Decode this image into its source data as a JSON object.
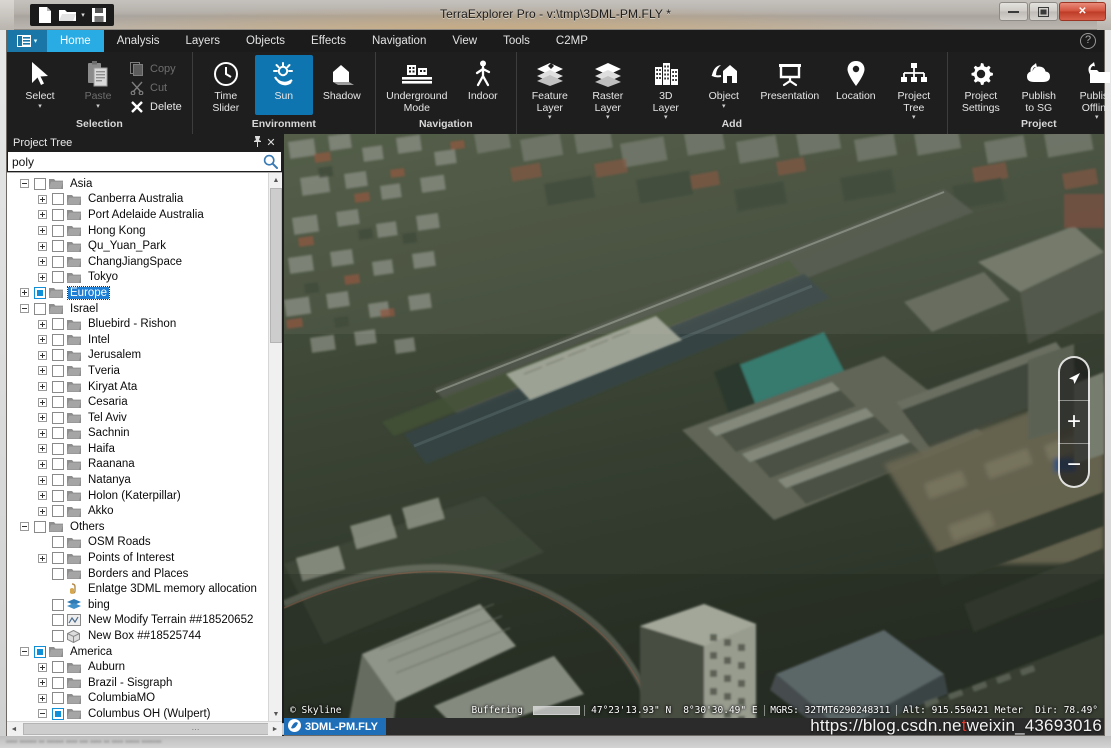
{
  "window": {
    "title": "TerraExplorer Pro - v:\\tmp\\3DML-PM.FLY *",
    "minimize": "—",
    "maximize": "❐",
    "close": "✕"
  },
  "quick_access": {
    "new": "new-document",
    "open": "open-folder",
    "open_caret": "▾",
    "save": "save-disk"
  },
  "ribbon": {
    "app_menu_caret": "▾",
    "help": "?",
    "tabs": [
      {
        "label": "Home",
        "active": true
      },
      {
        "label": "Analysis",
        "active": false
      },
      {
        "label": "Layers",
        "active": false
      },
      {
        "label": "Objects",
        "active": false
      },
      {
        "label": "Effects",
        "active": false
      },
      {
        "label": "Navigation",
        "active": false
      },
      {
        "label": "View",
        "active": false
      },
      {
        "label": "Tools",
        "active": false
      },
      {
        "label": "C2MP",
        "active": false
      }
    ],
    "groups": [
      {
        "title": "Selection",
        "big": [
          {
            "label": "Select",
            "caret": "▾",
            "icon": "cursor-arrow-icon",
            "selected": false,
            "disabled": false
          },
          {
            "label": "Paste",
            "caret": "▾",
            "icon": "clipboard-paste-icon",
            "selected": false,
            "disabled": true
          }
        ],
        "small": [
          {
            "label": "Copy",
            "icon": "copy-icon",
            "disabled": true
          },
          {
            "label": "Cut",
            "icon": "scissors-cut-icon",
            "disabled": true
          },
          {
            "label": "Delete",
            "icon": "delete-x-icon",
            "disabled": false
          }
        ]
      },
      {
        "title": "Environment",
        "big": [
          {
            "label": "Time\nSlider",
            "caret": "",
            "icon": "clock-icon",
            "selected": false,
            "disabled": false
          },
          {
            "label": "Sun",
            "caret": "",
            "icon": "sun-icon",
            "selected": true,
            "disabled": false
          },
          {
            "label": "Shadow",
            "caret": "",
            "icon": "house-shadow-icon",
            "selected": false,
            "disabled": false
          }
        ],
        "small": []
      },
      {
        "title": "Navigation",
        "big": [
          {
            "label": "Underground\nMode",
            "caret": "",
            "icon": "underground-building-icon",
            "selected": false,
            "disabled": false
          },
          {
            "label": "Indoor",
            "caret": "",
            "icon": "walking-person-icon",
            "selected": false,
            "disabled": false
          }
        ],
        "small": []
      },
      {
        "title": "Add",
        "big": [
          {
            "label": "Feature\nLayer",
            "caret": "▾",
            "icon": "feature-layer-icon",
            "selected": false,
            "disabled": false
          },
          {
            "label": "Raster\nLayer",
            "caret": "▾",
            "icon": "raster-layer-icon",
            "selected": false,
            "disabled": false
          },
          {
            "label": "3D\nLayer",
            "caret": "▾",
            "icon": "3d-layer-icon",
            "selected": false,
            "disabled": false
          },
          {
            "label": "Object",
            "caret": "▾",
            "icon": "object-house-icon",
            "selected": false,
            "disabled": false
          },
          {
            "label": "Presentation",
            "caret": "",
            "icon": "presentation-icon",
            "selected": false,
            "disabled": false
          },
          {
            "label": "Location",
            "caret": "",
            "icon": "map-pin-icon",
            "selected": false,
            "disabled": false
          },
          {
            "label": "Project\nTree",
            "caret": "▾",
            "icon": "project-tree-icon",
            "selected": false,
            "disabled": false
          }
        ],
        "small": []
      },
      {
        "title": "Project",
        "big": [
          {
            "label": "Project\nSettings",
            "caret": "",
            "icon": "gear-icon",
            "selected": false,
            "disabled": false
          },
          {
            "label": "Publish\nto SG",
            "caret": "",
            "icon": "publish-cloud-icon",
            "selected": false,
            "disabled": false
          },
          {
            "label": "Publish\nOffline",
            "caret": "▾",
            "icon": "publish-folder-icon",
            "selected": false,
            "disabled": false
          }
        ],
        "small": []
      }
    ]
  },
  "project_tree": {
    "title": "Project Tree",
    "pin_icon": "📌",
    "close_icon": "✕",
    "search_value": "poly",
    "search_placeholder": "",
    "search_icon": "search-icon",
    "nodes": [
      {
        "label": "Asia",
        "depth": 0,
        "expander": "minus",
        "checkbox": "empty",
        "icon": "folder",
        "selected": false
      },
      {
        "label": "Canberra Australia",
        "depth": 1,
        "expander": "plus",
        "checkbox": "empty",
        "icon": "folder",
        "selected": false
      },
      {
        "label": "Port Adelaide Australia",
        "depth": 1,
        "expander": "plus",
        "checkbox": "empty",
        "icon": "folder",
        "selected": false
      },
      {
        "label": "Hong Kong",
        "depth": 1,
        "expander": "plus",
        "checkbox": "empty",
        "icon": "folder",
        "selected": false
      },
      {
        "label": "Qu_Yuan_Park",
        "depth": 1,
        "expander": "plus",
        "checkbox": "empty",
        "icon": "folder",
        "selected": false
      },
      {
        "label": "ChangJiangSpace",
        "depth": 1,
        "expander": "plus",
        "checkbox": "empty",
        "icon": "folder",
        "selected": false
      },
      {
        "label": "Tokyo",
        "depth": 1,
        "expander": "plus",
        "checkbox": "empty",
        "icon": "folder",
        "selected": false
      },
      {
        "label": "Europe",
        "depth": 0,
        "expander": "plus",
        "checkbox": "filled",
        "icon": "folder",
        "selected": true
      },
      {
        "label": "Israel",
        "depth": 0,
        "expander": "minus",
        "checkbox": "empty",
        "icon": "folder",
        "selected": false
      },
      {
        "label": "Bluebird - Rishon",
        "depth": 1,
        "expander": "plus",
        "checkbox": "empty",
        "icon": "folder",
        "selected": false
      },
      {
        "label": "Intel",
        "depth": 1,
        "expander": "plus",
        "checkbox": "empty",
        "icon": "folder",
        "selected": false
      },
      {
        "label": "Jerusalem",
        "depth": 1,
        "expander": "plus",
        "checkbox": "empty",
        "icon": "folder",
        "selected": false
      },
      {
        "label": "Tveria",
        "depth": 1,
        "expander": "plus",
        "checkbox": "empty",
        "icon": "folder",
        "selected": false
      },
      {
        "label": "Kiryat Ata",
        "depth": 1,
        "expander": "plus",
        "checkbox": "empty",
        "icon": "folder",
        "selected": false
      },
      {
        "label": "Cesaria",
        "depth": 1,
        "expander": "plus",
        "checkbox": "empty",
        "icon": "folder",
        "selected": false
      },
      {
        "label": "Tel Aviv",
        "depth": 1,
        "expander": "plus",
        "checkbox": "empty",
        "icon": "folder",
        "selected": false
      },
      {
        "label": "Sachnin",
        "depth": 1,
        "expander": "plus",
        "checkbox": "empty",
        "icon": "folder",
        "selected": false
      },
      {
        "label": "Haifa",
        "depth": 1,
        "expander": "plus",
        "checkbox": "empty",
        "icon": "folder",
        "selected": false
      },
      {
        "label": "Raanana",
        "depth": 1,
        "expander": "plus",
        "checkbox": "empty",
        "icon": "folder",
        "selected": false
      },
      {
        "label": "Natanya",
        "depth": 1,
        "expander": "plus",
        "checkbox": "empty",
        "icon": "folder",
        "selected": false
      },
      {
        "label": "Holon (Katerpillar)",
        "depth": 1,
        "expander": "plus",
        "checkbox": "empty",
        "icon": "folder",
        "selected": false
      },
      {
        "label": "Akko",
        "depth": 1,
        "expander": "plus",
        "checkbox": "empty",
        "icon": "folder",
        "selected": false
      },
      {
        "label": "Others",
        "depth": 0,
        "expander": "minus",
        "checkbox": "empty",
        "icon": "folder",
        "selected": false
      },
      {
        "label": "OSM Roads",
        "depth": 1,
        "expander": "none",
        "checkbox": "empty",
        "icon": "folder",
        "selected": false
      },
      {
        "label": "Points of Interest",
        "depth": 1,
        "expander": "plus",
        "checkbox": "empty",
        "icon": "folder",
        "selected": false
      },
      {
        "label": "Borders and Places",
        "depth": 1,
        "expander": "none",
        "checkbox": "empty",
        "icon": "folder",
        "selected": false
      },
      {
        "label": "Enlatge 3DML memory allocation",
        "depth": 1,
        "expander": "none",
        "checkbox": "hidden",
        "icon": "script",
        "selected": false
      },
      {
        "label": "bing",
        "depth": 1,
        "expander": "none",
        "checkbox": "empty",
        "icon": "layers",
        "selected": false
      },
      {
        "label": "New Modify Terrain ##18520652",
        "depth": 1,
        "expander": "none",
        "checkbox": "empty",
        "icon": "terrain",
        "selected": false
      },
      {
        "label": "New Box ##18525744",
        "depth": 1,
        "expander": "none",
        "checkbox": "empty",
        "icon": "box",
        "selected": false
      },
      {
        "label": "America",
        "depth": 0,
        "expander": "minus",
        "checkbox": "filled",
        "icon": "folder",
        "selected": false
      },
      {
        "label": "Auburn",
        "depth": 1,
        "expander": "plus",
        "checkbox": "empty",
        "icon": "folder",
        "selected": false
      },
      {
        "label": "Brazil - Sisgraph",
        "depth": 1,
        "expander": "plus",
        "checkbox": "empty",
        "icon": "folder",
        "selected": false
      },
      {
        "label": "ColumbiaMO",
        "depth": 1,
        "expander": "plus",
        "checkbox": "empty",
        "icon": "folder",
        "selected": false
      },
      {
        "label": "Columbus OH (Wulpert)",
        "depth": 1,
        "expander": "minus",
        "checkbox": "filled",
        "icon": "folder",
        "selected": false
      }
    ],
    "scroll_up": "▲",
    "scroll_down": "▼",
    "scroll_left": "◄",
    "scroll_right": "►",
    "hthumb_grip": "⋯"
  },
  "view3d": {
    "nav": {
      "compass": "compass-arrow-icon",
      "zoom_in": "+",
      "zoom_out": "−"
    }
  },
  "status_bar": {
    "copyright": "© Skyline",
    "buffering_label": "Buffering",
    "latitude": "47°23'13.93\" N",
    "longitude": "8°30'30.49\" E",
    "mgrs": "MGRS: 32TMT6290248311",
    "altitude": "Alt: 915.550421 Meter",
    "direction": "Dir: 78.49°"
  },
  "taskbar": {
    "item_label": "3DML-PM.FLY",
    "item_icon": "terraexplorer-icon",
    "watermark_left": "https://blog.csdn.ne",
    "watermark_mid": "t",
    "watermark_right": "weixin_43693016"
  },
  "colors": {
    "accent_tab": "#29ace3",
    "accent_selected_button": "#0f75b0",
    "tree_selection": "#1f7fd4",
    "checkbox_filled": "#0f8fd8",
    "ribbon_bg": "#1e1e1e",
    "taskbar_item": "#1f6fb8",
    "close_button": "#c9432c"
  }
}
